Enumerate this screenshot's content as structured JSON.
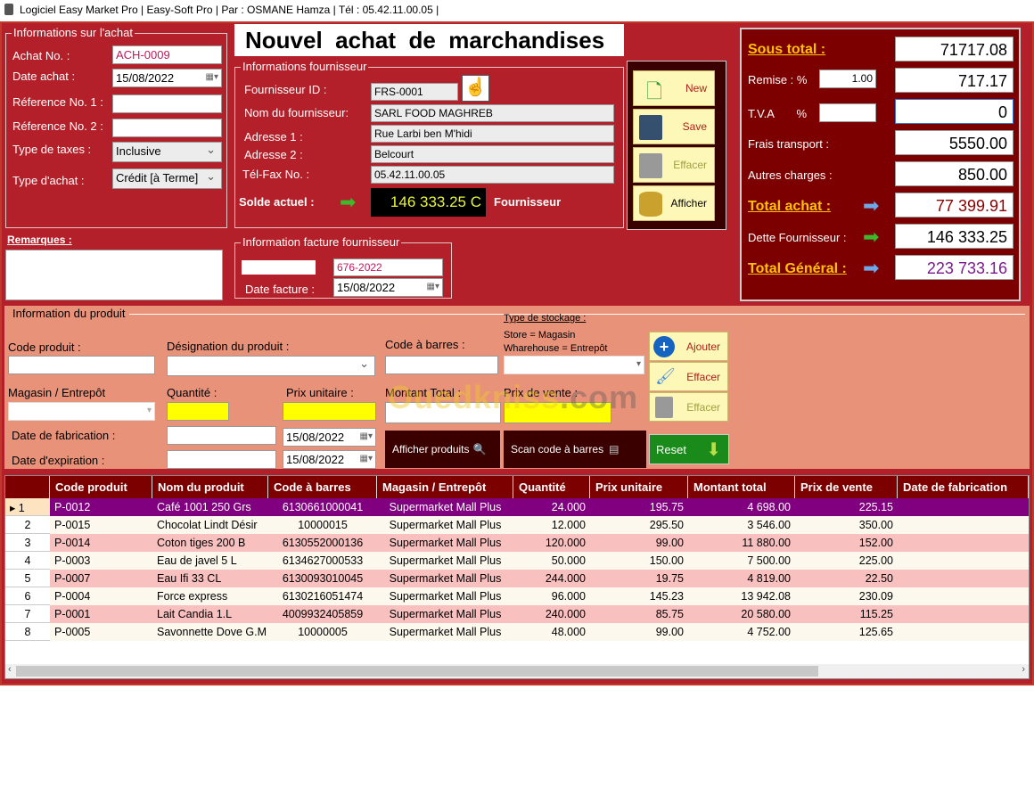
{
  "window": {
    "title": "Logiciel Easy Market Pro | Easy-Soft Pro | Par : OSMANE Hamza | Tél : 05.42.11.00.05 |"
  },
  "achat": {
    "legend": "Informations sur l'achat",
    "no_label": "Achat No. :",
    "no": "ACH-0009",
    "date_label": "Date  achat :",
    "date": "15/08/2022",
    "ref1_label": "Réference No. 1 :",
    "ref2_label": "Réference No. 2 :",
    "ref1": "",
    "ref2": "",
    "taxes_label": "Type  de taxes :",
    "taxes": "Inclusive",
    "type_label": "Type  d'achat :",
    "type": "Crédit [à Terme]"
  },
  "remarques_label": "Remarques :",
  "page_title": "Nouvel  achat  de  marchandises",
  "fournisseur": {
    "legend": "Informations fournisseur",
    "id_label": "Fournisseur ID :",
    "id": "FRS-0001",
    "nom_label": "Nom du fournisseur:",
    "nom": "SARL FOOD MAGHREB",
    "adr1_label": "Adresse 1 :",
    "adr1": "Rue Larbi ben M'hidi",
    "adr2_label": "Adresse 2 :",
    "adr2": "Belcourt",
    "tel_label": "Tél-Fax No. :",
    "tel": "05.42.11.00.05",
    "solde_label": "Solde actuel :",
    "solde": "146 333.25 C",
    "solde_suffix": "Fournisseur"
  },
  "facture": {
    "legend": "Information facture fournisseur",
    "no": "676-2022",
    "date_label": "Date facture :",
    "date": "15/08/2022"
  },
  "actions": {
    "new": "New",
    "save": "Save",
    "effacer": "Effacer",
    "afficher": "Afficher"
  },
  "totaux": {
    "sous_total_label": "Sous total :",
    "sous_total": "71717.08",
    "remise_label": "Remise :  %",
    "remise_pct": "1.00",
    "remise": "717.17",
    "tva_label": "T.V.A       %",
    "tva_pct": "",
    "tva": "0",
    "transport_label": "Frais transport :",
    "transport": "5550.00",
    "autres_label": "Autres charges :",
    "autres": "850.00",
    "total_achat_label": "Total achat :",
    "total_achat": "77 399.91",
    "dette_label": "Dette Fournisseur :",
    "dette": "146 333.25",
    "general_label": "Total  Général :",
    "general": "223 733.16"
  },
  "produit": {
    "legend": "Information du produit",
    "code_label": "Code produit :",
    "designation_label": "Désignation du produit :",
    "barres_label": "Code à barres :",
    "stockage_title": "Type de stockage :",
    "stockage_line1": "Store = Magasin",
    "stockage_line2": "Wharehouse = Entrepôt",
    "magasin_label": "Magasin / Entrepôt",
    "quantite_label": "Quantité :",
    "prix_label": "Prix unitaire :",
    "montant_label": "Montant Total :",
    "vente_label": "Prix de vente  :",
    "fabrication_label": "Date de fabrication :",
    "expiration_label": "Date d'expiration  :",
    "fabrication_date": "15/08/2022",
    "expiration_date": "15/08/2022",
    "ajouter": "Ajouter",
    "effacer1": "Effacer",
    "effacer2": "Effacer",
    "afficher_produits": "Afficher produits",
    "scan": "Scan code à barres",
    "reset": "Reset"
  },
  "watermark": "Ouedkniss.com",
  "table": {
    "columns": [
      "Code produit",
      "Nom du produit",
      "Code à barres",
      "Magasin / Entrepôt",
      "Quantité",
      "Prix unitaire",
      "Montant total",
      "Prix de vente",
      "Date de fabrication"
    ],
    "rows": [
      [
        "1",
        "P-0012",
        "Café 1001 250 Grs",
        "6130661000041",
        "Supermarket Mall Plus",
        "24.000",
        "195.75",
        "4 698.00",
        "225.15",
        ""
      ],
      [
        "2",
        "P-0015",
        "Chocolat Lindt Désir",
        "10000015",
        "Supermarket Mall Plus",
        "12.000",
        "295.50",
        "3 546.00",
        "350.00",
        ""
      ],
      [
        "3",
        "P-0014",
        "Coton tiges 200 B",
        "6130552000136",
        "Supermarket Mall Plus",
        "120.000",
        "99.00",
        "11 880.00",
        "152.00",
        ""
      ],
      [
        "4",
        "P-0003",
        "Eau de javel 5 L",
        "6134627000533",
        "Supermarket Mall Plus",
        "50.000",
        "150.00",
        "7 500.00",
        "225.00",
        ""
      ],
      [
        "5",
        "P-0007",
        "Eau Ifi 33 CL",
        "6130093010045",
        "Supermarket Mall Plus",
        "244.000",
        "19.75",
        "4 819.00",
        "22.50",
        ""
      ],
      [
        "6",
        "P-0004",
        "Force express",
        "6130216051474",
        "Supermarket Mall Plus",
        "96.000",
        "145.23",
        "13 942.08",
        "230.09",
        ""
      ],
      [
        "7",
        "P-0001",
        "Lait Candia 1.L",
        "4009932405859",
        "Supermarket Mall Plus",
        "240.000",
        "85.75",
        "20 580.00",
        "115.25",
        ""
      ],
      [
        "8",
        "P-0005",
        "Savonnette Dove G.M",
        "10000005",
        "Supermarket Mall Plus",
        "48.000",
        "99.00",
        "4 752.00",
        "125.65",
        ""
      ]
    ]
  },
  "colors": {
    "window": "#b3202a",
    "panel": "#7d0000",
    "product_area": "#e8927a",
    "selected_row": "#800080",
    "row_alt": "#f9c0c0",
    "row": "#fdf8ee",
    "highlight_input": "#ffff00"
  }
}
